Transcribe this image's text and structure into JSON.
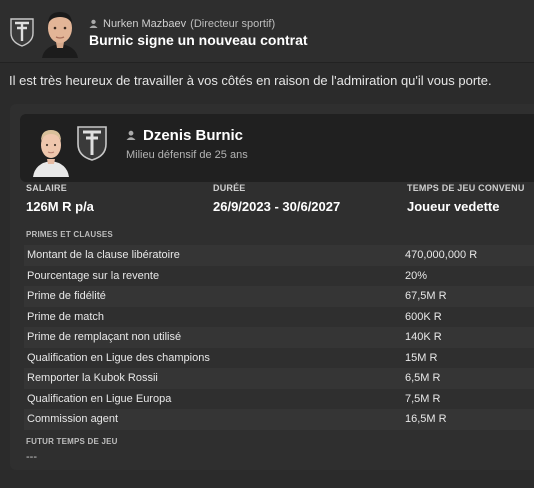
{
  "header": {
    "sender_name": "Nurken Mazbaev",
    "sender_role": "(Directeur sportif)",
    "subject": "Burnic signe un nouveau contrat"
  },
  "message": {
    "text": "Il est très heureux de travailler à vos côtés en raison de l'admiration qu'il vous porte."
  },
  "player": {
    "name": "Dzenis Burnic",
    "description": "Milieu défensif de 25 ans"
  },
  "contract": {
    "salary_label": "SALAIRE",
    "salary_value": "126M R p/a",
    "duration_label": "DURÉE",
    "duration_value": "26/9/2023 - 30/6/2027",
    "playing_time_label": "TEMPS DE JEU CONVENU",
    "playing_time_value": "Joueur vedette"
  },
  "clauses_title": "PRIMES ET CLAUSES",
  "clauses": [
    {
      "label": "Montant de la clause libératoire",
      "value": "470,000,000 R"
    },
    {
      "label": "Pourcentage sur la revente",
      "value": "20%"
    },
    {
      "label": "Prime de fidélité",
      "value": "67,5M R"
    },
    {
      "label": "Prime de match",
      "value": "600K R"
    },
    {
      "label": "Prime de remplaçant non utilisé",
      "value": "140K R"
    },
    {
      "label": "Qualification en Ligue des champions",
      "value": "15M R"
    },
    {
      "label": "Remporter la Kubok Rossii",
      "value": "6,5M R"
    },
    {
      "label": "Qualification en Ligue Europa",
      "value": "7,5M R"
    },
    {
      "label": "Commission agent",
      "value": "16,5M R"
    }
  ],
  "future_title": "FUTUR TEMPS DE JEU",
  "future_value": "---",
  "colors": {
    "background": "#2b2b2b",
    "card": "#2f2f2f",
    "player_box": "#202020",
    "row_alt": "#353535"
  }
}
